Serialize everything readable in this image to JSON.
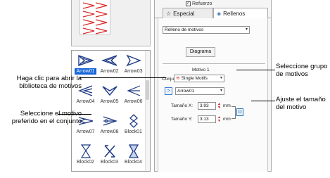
{
  "preview": {
    "label": "Motivo 1"
  },
  "motifs": [
    {
      "label": "Arrow01",
      "icon": "arrow01-icon",
      "selected": true
    },
    {
      "label": "Arrow02",
      "icon": "arrow02-icon"
    },
    {
      "label": "Arrow03",
      "icon": "arrow03-icon"
    },
    {
      "label": "Arrow04",
      "icon": "arrow04-icon"
    },
    {
      "label": "Arrow05",
      "icon": "arrow05-icon"
    },
    {
      "label": "Arrow06",
      "icon": "arrow06-icon"
    },
    {
      "label": "Arrow07",
      "icon": "arrow07-icon"
    },
    {
      "label": "Arrow08",
      "icon": "arrow08-icon"
    },
    {
      "label": "Block01",
      "icon": "block01-icon"
    },
    {
      "label": "Block02",
      "icon": "block02-icon"
    },
    {
      "label": "Block03",
      "icon": "block03-icon"
    },
    {
      "label": "Block04",
      "icon": "block04-icon"
    }
  ],
  "tabs": {
    "refuerzo": "Refuerzo",
    "especial": "Especial",
    "rellenos": "Rellenos"
  },
  "fill": {
    "type_value": "Relleno de motivos",
    "diagram_button": "Diagrama",
    "section_title": "Motivo 1",
    "set_label": "Conju",
    "set_value": "Single Motifs",
    "motif_value": "Arrow01",
    "size_x_label": "Tamaño X:",
    "size_x_value": "3.93",
    "size_y_label": "Tamaño Y:",
    "size_y_value": "3.13",
    "unit": "mm"
  },
  "callouts": {
    "library": "Haga clic para abrir la biblioteca de motivos",
    "preferred": "Seleccione el motivo preferido en el conjunto",
    "group": "Seleccione grupo de motivos",
    "size": "Ajuste el tamaño del motivo"
  },
  "colors": {
    "motif_stroke": "#1f3b86",
    "preview_red": "#d82a2a",
    "select_blue": "#1565d8"
  }
}
